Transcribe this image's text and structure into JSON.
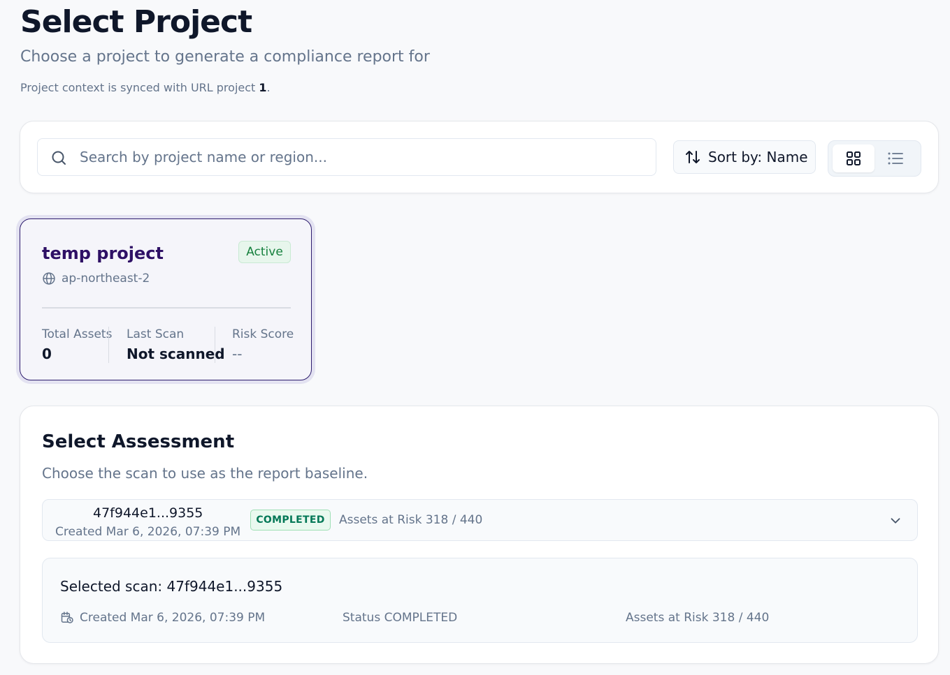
{
  "header": {
    "title": "Select Project",
    "subtitle": "Choose a project to generate a compliance report for",
    "sync_note_prefix": "Project context is synced with URL project ",
    "sync_project": "1",
    "sync_note_suffix": "."
  },
  "toolbar": {
    "search_placeholder": "Search by project name or region...",
    "search_value": "",
    "sort_label": "Sort by: Name",
    "view_mode": "grid"
  },
  "project": {
    "name": "temp project",
    "status": "Active",
    "region": "ap-northeast-2",
    "stats": {
      "total_assets_label": "Total Assets",
      "total_assets_value": "0",
      "last_scan_label": "Last Scan",
      "last_scan_value": "Not scanned",
      "risk_score_label": "Risk Score",
      "risk_score_value": "--"
    }
  },
  "assessment": {
    "title": "Select Assessment",
    "subtitle": "Choose the scan to use as the report baseline.",
    "scan": {
      "id": "47f944e1...9355",
      "created": "Created Mar 6, 2026, 07:39 PM",
      "status": "COMPLETED",
      "assets_at_risk": "Assets at Risk 318 / 440"
    },
    "selected": {
      "title": "Selected scan: 47f944e1...9355",
      "created": "Created Mar 6, 2026, 07:39 PM",
      "status": "Status COMPLETED",
      "assets_at_risk": "Assets at Risk 318 / 440"
    }
  },
  "colors": {
    "accent": "#2e1065",
    "success": "#15803d",
    "muted_text": "#64748b"
  }
}
